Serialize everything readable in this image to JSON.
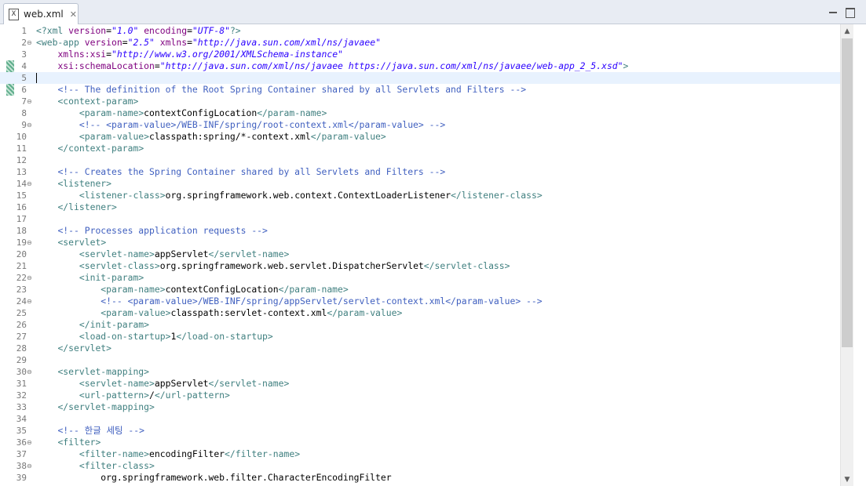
{
  "tab": {
    "title": "web.xml",
    "icon_letter": "X"
  },
  "colors": {
    "tag": "#3f7f7f",
    "attribute": "#7f007f",
    "value": "#2a00ff",
    "comment": "#3f5fbf",
    "text": "#000000",
    "current_line": "#e8f2fe"
  },
  "editor": {
    "current_line": 5,
    "changed_lines": [
      4,
      5,
      6
    ],
    "lines": [
      {
        "n": "1",
        "fold": "",
        "code": "<?xml version=\"1.0\" encoding=\"UTF-8\"?>"
      },
      {
        "n": "2",
        "fold": "⊖",
        "code": "<web-app version=\"2.5\" xmlns=\"http://java.sun.com/xml/ns/javaee\""
      },
      {
        "n": "3",
        "fold": "",
        "code": "    xmlns:xsi=\"http://www.w3.org/2001/XMLSchema-instance\""
      },
      {
        "n": "4",
        "fold": "",
        "code": "    xsi:schemaLocation=\"http://java.sun.com/xml/ns/javaee https://java.sun.com/xml/ns/javaee/web-app_2_5.xsd\">"
      },
      {
        "n": "5",
        "fold": "",
        "code": ""
      },
      {
        "n": "6",
        "fold": "",
        "code": "    <!-- The definition of the Root Spring Container shared by all Servlets and Filters -->"
      },
      {
        "n": "7",
        "fold": "⊖",
        "code": "    <context-param>"
      },
      {
        "n": "8",
        "fold": "",
        "code": "        <param-name>contextConfigLocation</param-name>"
      },
      {
        "n": "9",
        "fold": "⊖",
        "code": "        <!-- <param-value>/WEB-INF/spring/root-context.xml</param-value> -->"
      },
      {
        "n": "10",
        "fold": "",
        "code": "        <param-value>classpath:spring/*-context.xml</param-value>"
      },
      {
        "n": "11",
        "fold": "",
        "code": "    </context-param>"
      },
      {
        "n": "12",
        "fold": "",
        "code": ""
      },
      {
        "n": "13",
        "fold": "",
        "code": "    <!-- Creates the Spring Container shared by all Servlets and Filters -->"
      },
      {
        "n": "14",
        "fold": "⊖",
        "code": "    <listener>"
      },
      {
        "n": "15",
        "fold": "",
        "code": "        <listener-class>org.springframework.web.context.ContextLoaderListener</listener-class>"
      },
      {
        "n": "16",
        "fold": "",
        "code": "    </listener>"
      },
      {
        "n": "17",
        "fold": "",
        "code": ""
      },
      {
        "n": "18",
        "fold": "",
        "code": "    <!-- Processes application requests -->"
      },
      {
        "n": "19",
        "fold": "⊖",
        "code": "    <servlet>"
      },
      {
        "n": "20",
        "fold": "",
        "code": "        <servlet-name>appServlet</servlet-name>"
      },
      {
        "n": "21",
        "fold": "",
        "code": "        <servlet-class>org.springframework.web.servlet.DispatcherServlet</servlet-class>"
      },
      {
        "n": "22",
        "fold": "⊖",
        "code": "        <init-param>"
      },
      {
        "n": "23",
        "fold": "",
        "code": "            <param-name>contextConfigLocation</param-name>"
      },
      {
        "n": "24",
        "fold": "⊖",
        "code": "            <!-- <param-value>/WEB-INF/spring/appServlet/servlet-context.xml</param-value> -->"
      },
      {
        "n": "25",
        "fold": "",
        "code": "            <param-value>classpath:servlet-context.xml</param-value>"
      },
      {
        "n": "26",
        "fold": "",
        "code": "        </init-param>"
      },
      {
        "n": "27",
        "fold": "",
        "code": "        <load-on-startup>1</load-on-startup>"
      },
      {
        "n": "28",
        "fold": "",
        "code": "    </servlet>"
      },
      {
        "n": "29",
        "fold": "",
        "code": ""
      },
      {
        "n": "30",
        "fold": "⊖",
        "code": "    <servlet-mapping>"
      },
      {
        "n": "31",
        "fold": "",
        "code": "        <servlet-name>appServlet</servlet-name>"
      },
      {
        "n": "32",
        "fold": "",
        "code": "        <url-pattern>/</url-pattern>"
      },
      {
        "n": "33",
        "fold": "",
        "code": "    </servlet-mapping>"
      },
      {
        "n": "34",
        "fold": "",
        "code": ""
      },
      {
        "n": "35",
        "fold": "",
        "code": "    <!-- 한글 세팅 -->"
      },
      {
        "n": "36",
        "fold": "⊖",
        "code": "    <filter>"
      },
      {
        "n": "37",
        "fold": "",
        "code": "        <filter-name>encodingFilter</filter-name>"
      },
      {
        "n": "38",
        "fold": "⊖",
        "code": "        <filter-class>"
      },
      {
        "n": "39",
        "fold": "",
        "code": "            org.springframework.web.filter.CharacterEncodingFilter"
      }
    ]
  }
}
